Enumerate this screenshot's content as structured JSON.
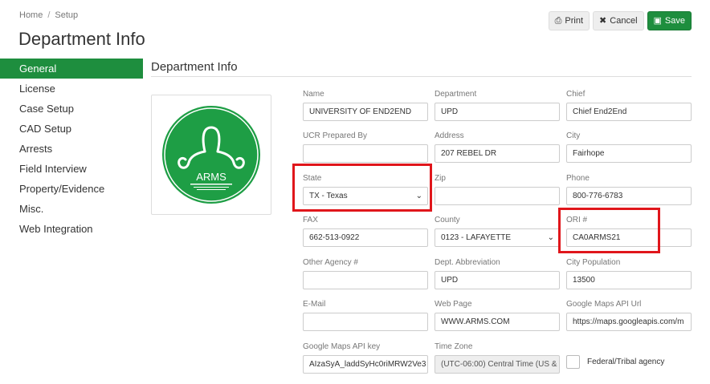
{
  "breadcrumb": {
    "home": "Home",
    "separator": "/",
    "current": "Setup"
  },
  "page_title": "Department Info",
  "toolbar": {
    "print_label": "Print",
    "cancel_label": "Cancel",
    "save_label": "Save"
  },
  "sidebar": {
    "items": [
      {
        "label": "General",
        "active": true
      },
      {
        "label": "License"
      },
      {
        "label": "Case Setup"
      },
      {
        "label": "CAD Setup"
      },
      {
        "label": "Arrests"
      },
      {
        "label": "Field Interview"
      },
      {
        "label": "Property/Evidence"
      },
      {
        "label": "Misc."
      },
      {
        "label": "Web Integration"
      }
    ]
  },
  "section_title": "Department Info",
  "logo": {
    "text": "ARMS",
    "colors": {
      "bg": "#1e9e45",
      "ring": "#ffffff"
    }
  },
  "form": {
    "name": {
      "label": "Name",
      "value": "UNIVERSITY OF END2END"
    },
    "department": {
      "label": "Department",
      "value": "UPD"
    },
    "chief": {
      "label": "Chief",
      "value": "Chief End2End"
    },
    "ucr_prepared_by": {
      "label": "UCR Prepared By",
      "value": ""
    },
    "address": {
      "label": "Address",
      "value": "207 REBEL DR"
    },
    "city": {
      "label": "City",
      "value": "Fairhope"
    },
    "state": {
      "label": "State",
      "value": "TX - Texas"
    },
    "zip": {
      "label": "Zip",
      "value": ""
    },
    "phone": {
      "label": "Phone",
      "value": "800-776-6783"
    },
    "fax": {
      "label": "FAX",
      "value": "662-513-0922"
    },
    "county": {
      "label": "County",
      "value": "0123 - LAFAYETTE"
    },
    "ori": {
      "label": "ORI #",
      "value": "CA0ARMS21"
    },
    "other_agency": {
      "label": "Other Agency #",
      "value": ""
    },
    "dept_abbrev": {
      "label": "Dept. Abbreviation",
      "value": "UPD"
    },
    "city_population": {
      "label": "City Population",
      "value": "13500"
    },
    "email": {
      "label": "E-Mail",
      "value": ""
    },
    "web_page": {
      "label": "Web Page",
      "value": "WWW.ARMS.COM"
    },
    "maps_api_url": {
      "label": "Google Maps API Url",
      "value": "https://maps.googleapis.com/m"
    },
    "maps_api_key": {
      "label": "Google Maps API key",
      "value": "AIzaSyA_laddSyHc0riMRW2Ve3"
    },
    "time_zone": {
      "label": "Time Zone",
      "value": "(UTC-06:00) Central Time (US &"
    },
    "federal_tribal": {
      "label": "Federal/Tribal agency",
      "checked": false
    }
  },
  "colors": {
    "accent": "#1e8e3e",
    "highlight": "#e0161b"
  }
}
